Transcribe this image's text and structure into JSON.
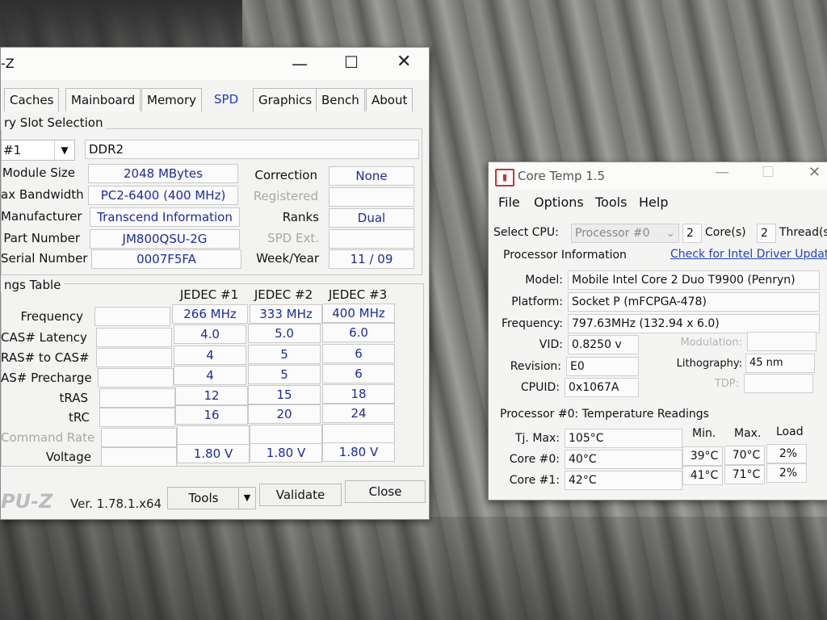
{
  "cpuz": {
    "title": "-Z",
    "tabs": [
      "Caches",
      "Mainboard",
      "Memory",
      "SPD",
      "Graphics",
      "Bench",
      "About"
    ],
    "slot_group_title": "ry Slot Selection",
    "slot": "#1",
    "memory_type": "DDR2",
    "labels": {
      "module_size": "Module Size",
      "max_bandwidth": "ax Bandwidth",
      "manufacturer": "Manufacturer",
      "part_number": "Part Number",
      "serial_number": "Serial Number",
      "correction": "Correction",
      "registered": "Registered",
      "ranks": "Ranks",
      "spd_ext": "SPD Ext.",
      "week_year": "Week/Year"
    },
    "values": {
      "module_size": "2048 MBytes",
      "max_bandwidth": "PC2-6400 (400 MHz)",
      "manufacturer": "Transcend Information",
      "part_number": "JM800QSU-2G",
      "serial_number": "0007F5FA",
      "correction": "None",
      "ranks": "Dual",
      "week_year": "11 / 09"
    },
    "timings": {
      "group_title": "ngs Table",
      "columns": [
        "JEDEC #1",
        "JEDEC #2",
        "JEDEC #3"
      ],
      "rows": [
        {
          "label": "Frequency",
          "values": [
            "266 MHz",
            "333 MHz",
            "400 MHz"
          ]
        },
        {
          "label": "CAS# Latency",
          "values": [
            "4.0",
            "5.0",
            "6.0"
          ]
        },
        {
          "label": "RAS# to CAS#",
          "values": [
            "4",
            "5",
            "6"
          ]
        },
        {
          "label": "AS# Precharge",
          "values": [
            "4",
            "5",
            "6"
          ]
        },
        {
          "label": "tRAS",
          "values": [
            "12",
            "15",
            "18"
          ]
        },
        {
          "label": "tRC",
          "values": [
            "16",
            "20",
            "24"
          ]
        },
        {
          "label": "Command Rate",
          "values": [
            "",
            "",
            ""
          ]
        },
        {
          "label": "Voltage",
          "values": [
            "1.80 V",
            "1.80 V",
            "1.80 V"
          ]
        }
      ]
    },
    "footer": {
      "logo": "PU-Z",
      "version": "Ver. 1.78.1.x64",
      "tools": "Tools",
      "validate": "Validate",
      "close": "Close"
    }
  },
  "coretemp": {
    "title": "Core Temp 1.5",
    "menu": [
      "File",
      "Options",
      "Tools",
      "Help"
    ],
    "select_cpu_label": "Select CPU:",
    "select_cpu_value": "Processor #0",
    "cores_count": "2",
    "cores_label": "Core(s)",
    "threads_count": "2",
    "threads_label": "Thread(s)",
    "proc_info_label": "Processor Information",
    "driver_link": "Check for Intel Driver Updates",
    "fields": {
      "model_label": "Model:",
      "model": "Mobile Intel Core 2 Duo T9900 (Penryn)",
      "platform_label": "Platform:",
      "platform": "Socket P (mFCPGA-478)",
      "frequency_label": "Frequency:",
      "frequency": "797.63MHz (132.94 x 6.0)",
      "vid_label": "VID:",
      "vid": "0.8250 v",
      "modulation_label": "Modulation:",
      "revision_label": "Revision:",
      "revision": "E0",
      "lithography_label": "Lithography:",
      "lithography": "45 nm",
      "cpuid_label": "CPUID:",
      "cpuid": "0x1067A",
      "tdp_label": "TDP:"
    },
    "temps": {
      "title": "Processor #0: Temperature Readings",
      "headers": {
        "min": "Min.",
        "max": "Max.",
        "load": "Load"
      },
      "tj_label": "Tj. Max:",
      "tj_value": "105°C",
      "cores": [
        {
          "label": "Core #0:",
          "temp": "40°C",
          "min": "39°C",
          "max": "70°C",
          "load": "2%"
        },
        {
          "label": "Core #1:",
          "temp": "42°C",
          "min": "41°C",
          "max": "71°C",
          "load": "2%"
        }
      ]
    }
  }
}
